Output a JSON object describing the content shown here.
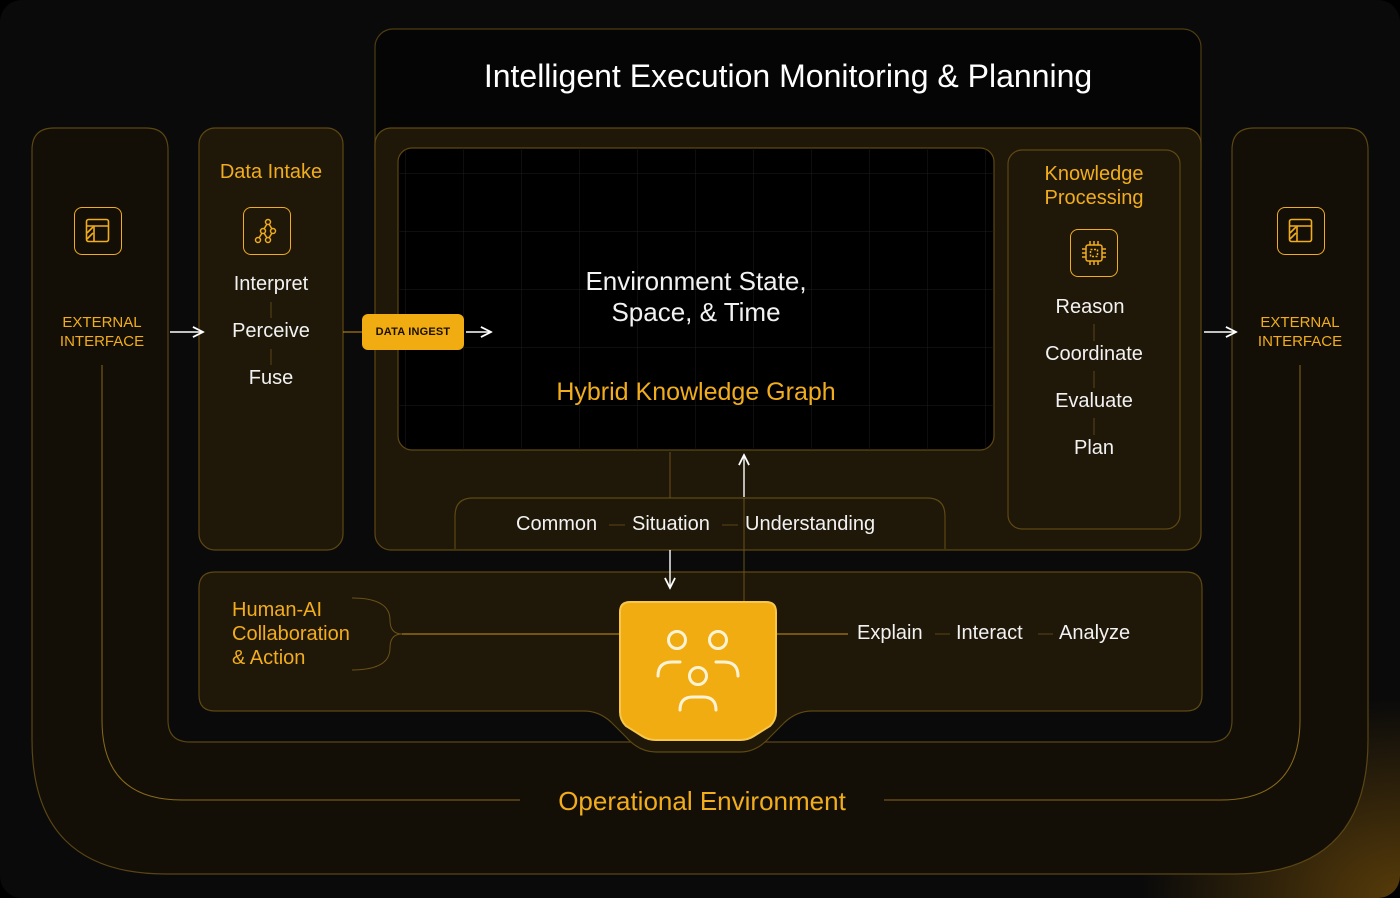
{
  "title": "Intelligent Execution Monitoring & Planning",
  "external_left": {
    "line1": "EXTERNAL",
    "line2": "INTERFACE",
    "icon": "table-icon"
  },
  "external_right": {
    "line1": "EXTERNAL",
    "line2": "INTERFACE",
    "icon": "table-icon"
  },
  "data_intake": {
    "heading": "Data Intake",
    "icon": "graph-nodes-icon",
    "steps": [
      "Interpret",
      "Perceive",
      "Fuse"
    ]
  },
  "data_ingest_label": "DATA INGEST",
  "environment": {
    "line1": "Environment State,",
    "line2": "Space, & Time",
    "graph_label": "Hybrid Knowledge Graph"
  },
  "knowledge_processing": {
    "heading_line1": "Knowledge",
    "heading_line2": "Processing",
    "icon": "chip-icon",
    "steps": [
      "Reason",
      "Coordinate",
      "Evaluate",
      "Plan"
    ]
  },
  "csu": [
    "Common",
    "Situation",
    "Understanding"
  ],
  "human_ai": {
    "line1": "Human-AI",
    "line2": "Collaboration",
    "line3": "& Action",
    "icon": "people-group-icon",
    "actions": [
      "Explain",
      "Interact",
      "Analyze"
    ]
  },
  "operational_environment": "Operational Environment",
  "colors": {
    "accent": "#f1ad1d",
    "panel": "#1f1708",
    "border": "#6b5216",
    "background": "#0a0a0a"
  }
}
